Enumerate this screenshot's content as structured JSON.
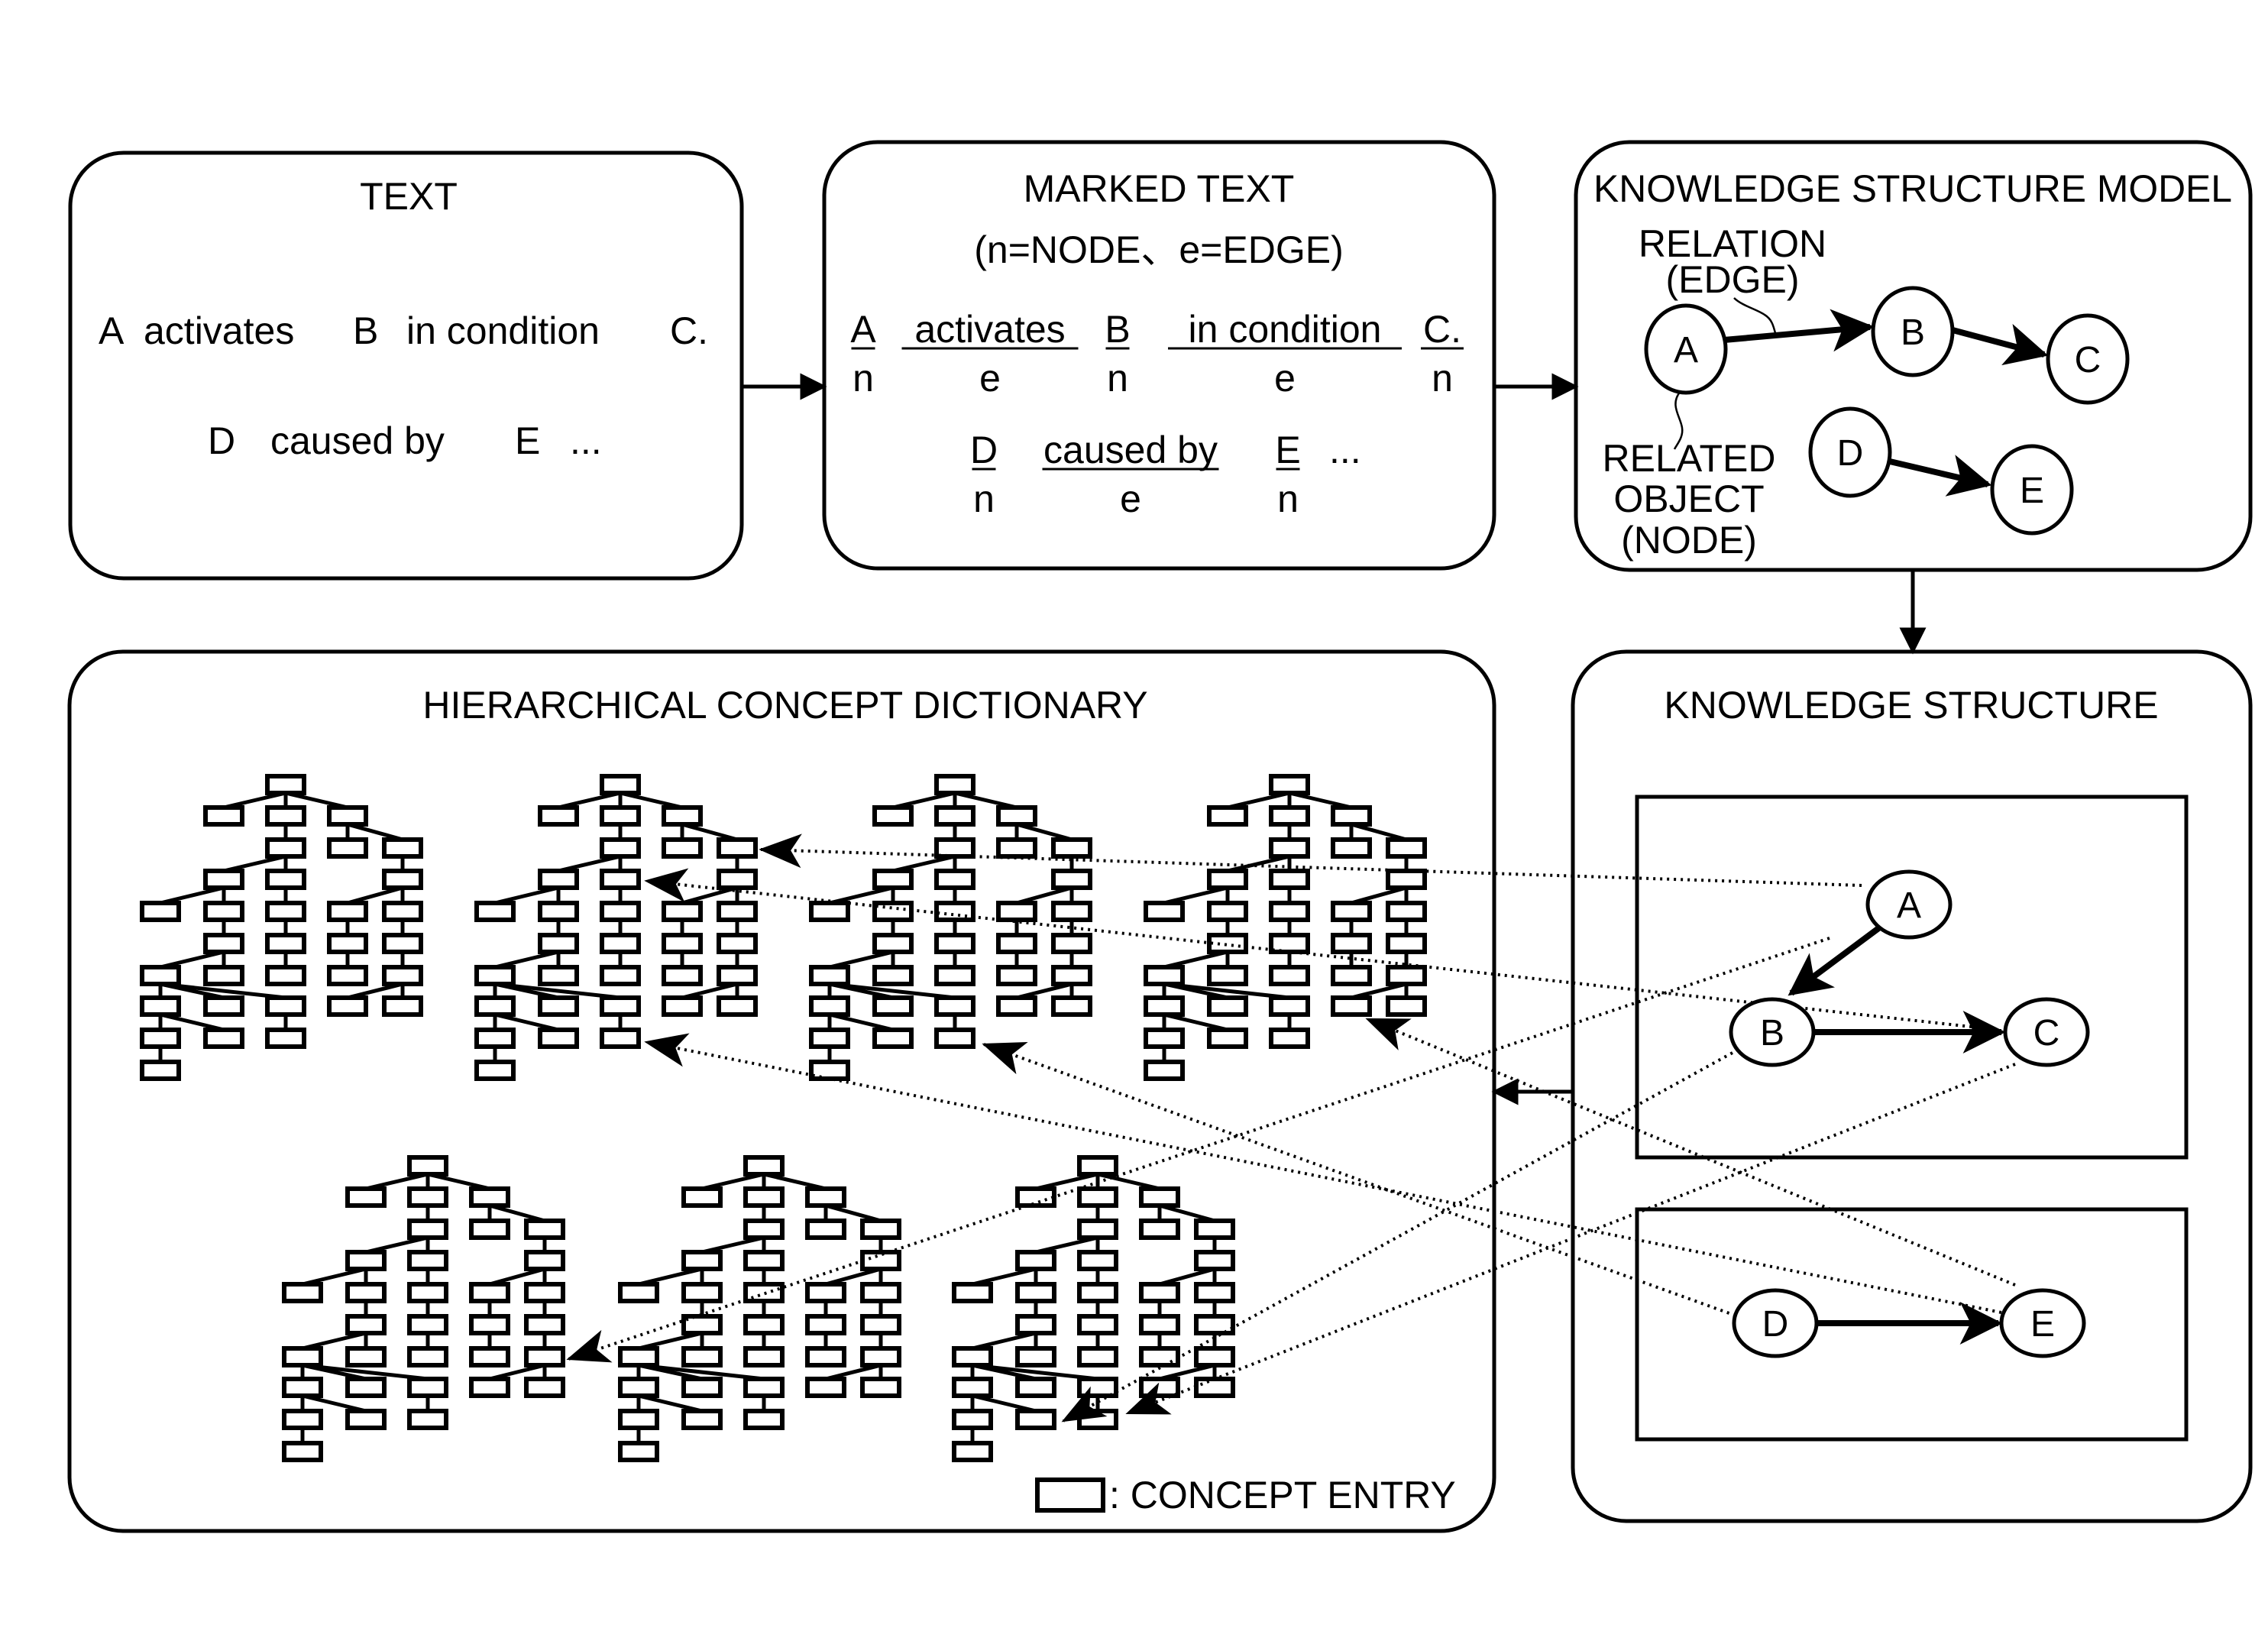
{
  "panels": {
    "text": {
      "title": "TEXT",
      "line1": [
        "A",
        "activates",
        "B",
        "in condition",
        "C."
      ],
      "line2": [
        "D",
        "caused by",
        "E",
        "..."
      ]
    },
    "marked_text": {
      "title": "MARKED TEXT",
      "subtitle": "(n=NODE、e=EDGE)",
      "row1": [
        {
          "word": "A",
          "mark": "n"
        },
        {
          "word": "activates",
          "mark": "e"
        },
        {
          "word": "B",
          "mark": "n"
        },
        {
          "word": "in condition",
          "mark": "e"
        },
        {
          "word": "C.",
          "mark": "n"
        }
      ],
      "row2": [
        {
          "word": "D",
          "mark": "n"
        },
        {
          "word": "caused by",
          "mark": "e"
        },
        {
          "word": "E",
          "mark": "n"
        }
      ],
      "row2_ellipsis": "..."
    },
    "knowledge_structure_model": {
      "title": "KNOWLEDGE STRUCTURE MODEL",
      "relation_label": [
        "RELATION",
        "(EDGE)"
      ],
      "node_label": [
        "RELATED",
        "OBJECT",
        "(NODE)"
      ],
      "nodes": [
        "A",
        "B",
        "C",
        "D",
        "E"
      ],
      "edges": [
        [
          "A",
          "B"
        ],
        [
          "B",
          "C"
        ],
        [
          "D",
          "E"
        ]
      ]
    },
    "knowledge_structure": {
      "title": "KNOWLEDGE STRUCTURE",
      "groups": [
        {
          "nodes": [
            "A",
            "B",
            "C"
          ],
          "edges": [
            [
              "A",
              "B"
            ],
            [
              "B",
              "C"
            ]
          ]
        },
        {
          "nodes": [
            "D",
            "E"
          ],
          "edges": [
            [
              "D",
              "E"
            ]
          ]
        }
      ]
    },
    "hierarchical_concept_dictionary": {
      "title": "HIERARCHICAL CONCEPT DICTIONARY",
      "tree_count": 7,
      "legend": ": CONCEPT ENTRY"
    }
  },
  "flow": [
    [
      "TEXT",
      "MARKED TEXT"
    ],
    [
      "MARKED TEXT",
      "KNOWLEDGE STRUCTURE MODEL"
    ],
    [
      "KNOWLEDGE STRUCTURE MODEL",
      "KNOWLEDGE STRUCTURE"
    ],
    [
      "KNOWLEDGE STRUCTURE",
      "HIERARCHICAL CONCEPT DICTIONARY"
    ]
  ],
  "concept_links": [
    {
      "from": "A",
      "to_tree": 2
    },
    {
      "from": "C",
      "to_tree": 2
    },
    {
      "from": "B",
      "to_tree": 7
    },
    {
      "from": "C",
      "to_tree": 7
    },
    {
      "from": "B",
      "to_tree": 5
    },
    {
      "from": "E",
      "to_tree": 4
    },
    {
      "from": "E",
      "to_tree": 2
    },
    {
      "from": "D",
      "to_tree": 3
    }
  ]
}
